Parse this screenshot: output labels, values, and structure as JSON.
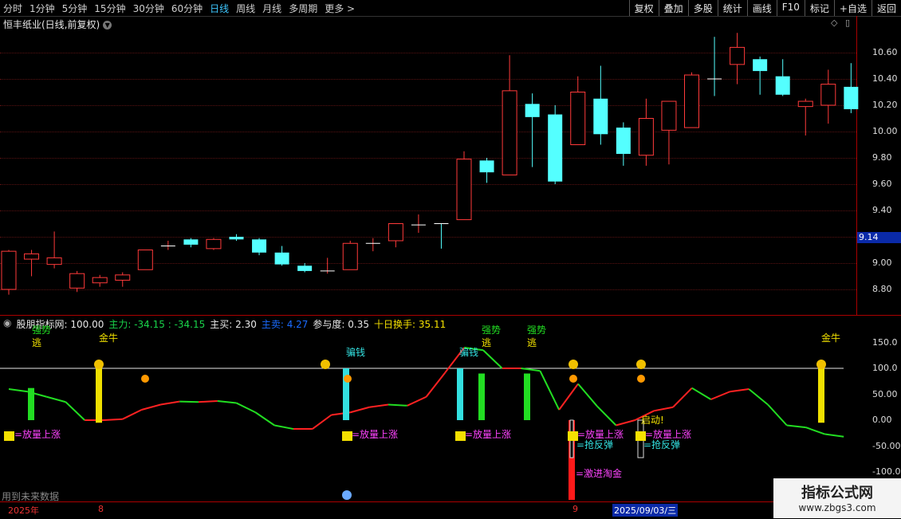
{
  "toolbar": {
    "periods": [
      "分时",
      "1分钟",
      "5分钟",
      "15分钟",
      "30分钟",
      "60分钟",
      "日线",
      "周线",
      "月线",
      "多周期",
      "更多 >"
    ],
    "active_period": "日线",
    "right_buttons": [
      "复权",
      "叠加",
      "多股",
      "统计",
      "画线",
      "F10",
      "标记",
      "+自选",
      "返回"
    ]
  },
  "stock": {
    "title": "恒丰纸业(日线,前复权)"
  },
  "price_axis": {
    "labels": [
      "10.60",
      "10.40",
      "10.20",
      "10.00",
      "9.80",
      "9.60",
      "9.40",
      "9.20",
      "9.00",
      "8.80"
    ],
    "current": "9.14"
  },
  "candles": [
    {
      "o": 8.8,
      "h": 9.1,
      "l": 8.76,
      "c": 9.09
    },
    {
      "o": 9.03,
      "h": 9.1,
      "l": 8.9,
      "c": 9.07
    },
    {
      "o": 8.99,
      "h": 9.24,
      "l": 8.96,
      "c": 9.04
    },
    {
      "o": 8.81,
      "h": 8.94,
      "l": 8.78,
      "c": 8.92
    },
    {
      "o": 8.85,
      "h": 8.91,
      "l": 8.82,
      "c": 8.89
    },
    {
      "o": 8.87,
      "h": 8.93,
      "l": 8.82,
      "c": 8.91
    },
    {
      "o": 8.95,
      "h": 9.1,
      "l": 8.95,
      "c": 9.1
    },
    {
      "o": 9.12,
      "h": 9.17,
      "l": 9.1,
      "c": 9.13
    },
    {
      "o": 9.18,
      "h": 9.19,
      "l": 9.12,
      "c": 9.14
    },
    {
      "o": 9.11,
      "h": 9.19,
      "l": 9.1,
      "c": 9.18
    },
    {
      "o": 9.2,
      "h": 9.22,
      "l": 9.17,
      "c": 9.18
    },
    {
      "o": 9.18,
      "h": 9.19,
      "l": 9.06,
      "c": 9.08
    },
    {
      "o": 9.08,
      "h": 9.13,
      "l": 8.98,
      "c": 8.99
    },
    {
      "o": 8.98,
      "h": 9.0,
      "l": 8.93,
      "c": 8.94
    },
    {
      "o": 8.94,
      "h": 9.04,
      "l": 8.92,
      "c": 8.94
    },
    {
      "o": 8.95,
      "h": 9.17,
      "l": 8.95,
      "c": 9.15
    },
    {
      "o": 9.15,
      "h": 9.19,
      "l": 9.09,
      "c": 9.15
    },
    {
      "o": 9.17,
      "h": 9.3,
      "l": 9.12,
      "c": 9.3
    },
    {
      "o": 9.29,
      "h": 9.37,
      "l": 9.23,
      "c": 9.29
    },
    {
      "o": 9.3,
      "h": 9.3,
      "l": 9.11,
      "c": 9.29
    },
    {
      "o": 9.33,
      "h": 9.85,
      "l": 9.33,
      "c": 9.79
    },
    {
      "o": 9.78,
      "h": 9.8,
      "l": 9.61,
      "c": 9.69
    },
    {
      "o": 9.67,
      "h": 10.58,
      "l": 9.67,
      "c": 10.31
    },
    {
      "o": 10.21,
      "h": 10.29,
      "l": 9.73,
      "c": 10.11
    },
    {
      "o": 10.13,
      "h": 10.2,
      "l": 9.6,
      "c": 9.62
    },
    {
      "o": 9.9,
      "h": 10.42,
      "l": 9.9,
      "c": 10.3
    },
    {
      "o": 10.25,
      "h": 10.5,
      "l": 9.9,
      "c": 9.98
    },
    {
      "o": 10.03,
      "h": 10.07,
      "l": 9.74,
      "c": 9.83
    },
    {
      "o": 9.82,
      "h": 10.25,
      "l": 9.74,
      "c": 10.1
    },
    {
      "o": 10.01,
      "h": 10.23,
      "l": 9.75,
      "c": 10.23
    },
    {
      "o": 10.03,
      "h": 10.45,
      "l": 10.03,
      "c": 10.43
    },
    {
      "o": 10.4,
      "h": 10.72,
      "l": 10.27,
      "c": 10.39
    },
    {
      "o": 10.51,
      "h": 10.75,
      "l": 10.36,
      "c": 10.64
    },
    {
      "o": 10.55,
      "h": 10.57,
      "l": 10.28,
      "c": 10.46
    },
    {
      "o": 10.42,
      "h": 10.55,
      "l": 10.27,
      "c": 10.28
    },
    {
      "o": 10.19,
      "h": 10.25,
      "l": 9.97,
      "c": 10.23
    },
    {
      "o": 10.2,
      "h": 10.47,
      "l": 10.06,
      "c": 10.36
    },
    {
      "o": 10.34,
      "h": 10.52,
      "l": 10.14,
      "c": 10.17
    }
  ],
  "indicator": {
    "name": "股朋指标网",
    "value": ": 100.00",
    "zhuli_label": "主力: -34.15 : -34.15",
    "zhumai_label": "主买: 2.30",
    "zhumai2_label": "主卖: 4.27",
    "canyu_label": "参与度: 0.35",
    "huanshou_label": "十日换手: 35.11",
    "axis_labels": [
      "150.0",
      "100.0",
      "50.00",
      "0.00",
      "-50.00",
      "-100.0"
    ],
    "line": [
      60,
      55,
      45,
      35,
      0,
      0,
      2,
      20,
      30,
      36,
      35,
      37,
      33,
      15,
      -10,
      -17,
      -17,
      10,
      15,
      25,
      30,
      28,
      45,
      92,
      140,
      135,
      100,
      100,
      95,
      20,
      70,
      27,
      -10,
      0,
      18,
      25,
      62,
      40,
      55,
      60,
      30,
      -10,
      -14,
      -27,
      -32
    ],
    "labels": {
      "escape": "逃",
      "escape_top": "强势",
      "gold_bull": "金牛",
      "cheat": "骗钱",
      "rise": "=放量上涨",
      "rebound": "=抢反弹",
      "dig": "=激进淘金",
      "start": "启动!"
    }
  },
  "footer": {
    "note": "用到未来数据",
    "dates": [
      "2025年",
      "8",
      "9",
      "2025/09/03/三"
    ]
  },
  "watermark": {
    "line1": "指标公式网",
    "line2": "www.zbgs3.com"
  }
}
